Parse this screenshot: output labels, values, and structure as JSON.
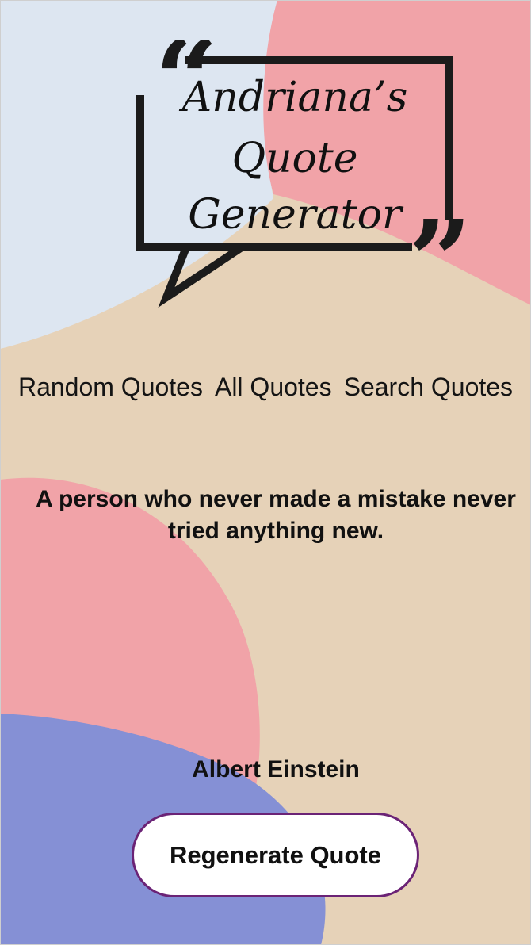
{
  "logo": {
    "lines": [
      "Andriana’s",
      "Quote",
      "Generator"
    ],
    "open_quote": "“",
    "close_quote": "”"
  },
  "nav": {
    "items": [
      {
        "label": "Random Quotes"
      },
      {
        "label": "All Quotes"
      },
      {
        "label": "Search Quotes"
      }
    ]
  },
  "quote": {
    "text": "A person who never made a mistake never tried anything new.",
    "author": "Albert Einstein"
  },
  "actions": {
    "regenerate_label": "Regenerate Quote"
  },
  "colors": {
    "background_beige": "#e6d2b8",
    "light_blue": "#dde6f1",
    "pink": "#f1a3a8",
    "periwinkle": "#8590d5",
    "button_border": "#6b2376"
  }
}
